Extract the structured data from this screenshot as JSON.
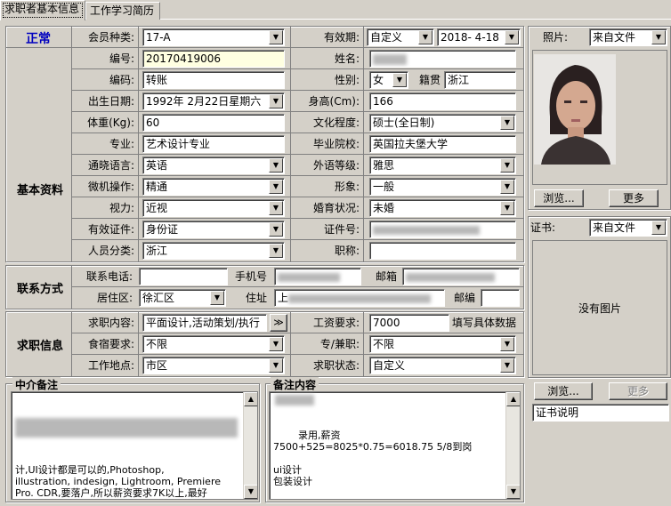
{
  "tabs": [
    "求职者基本信息",
    "工作学习简历"
  ],
  "status": "正常",
  "sections": {
    "basic": "基本资料",
    "contact": "联系方式",
    "job": "求职信息"
  },
  "labels": {
    "member_type": "会员种类:",
    "validity": "有效期:",
    "number": "编号:",
    "name": "姓名:",
    "code": "编码:",
    "gender": "性别:",
    "native": "籍贯",
    "birth": "出生日期:",
    "height": "身高(Cm):",
    "weight": "体重(Kg):",
    "education": "文化程度:",
    "major": "专业:",
    "school": "毕业院校:",
    "language": "通晓语言:",
    "lang_level": "外语等级:",
    "computer": "微机操作:",
    "image": "形象:",
    "eyesight": "视力:",
    "marital": "婚育状况:",
    "id_type": "有效证件:",
    "id_no": "证件号:",
    "category": "人员分类:",
    "title": "职称:",
    "phone": "联系电话:",
    "mobile": "手机号",
    "email": "邮箱",
    "district": "居住区:",
    "address": "住址",
    "postcode": "邮编",
    "job_content": "求职内容:",
    "salary": "工资要求:",
    "salary_note": "填写具体数据",
    "board": "食宿要求:",
    "fulltime": "专/兼职:",
    "location": "工作地点:",
    "job_status": "求职状态:",
    "agency_note": "中介备注",
    "remark": "备注内容",
    "photo": "照片:",
    "cert": "证书:"
  },
  "values": {
    "member_type": "17-A",
    "validity_type": "自定义",
    "validity_date": "2018- 4-18",
    "number": "20170419006",
    "code": "转账",
    "gender": "女",
    "native": "浙江",
    "birth": "1992年 2月22日星期六",
    "height": "166",
    "weight": "60",
    "education": "硕士(全日制)",
    "major": "艺术设计专业",
    "school": "英国拉夫堡大学",
    "language": "英语",
    "lang_level": "雅思",
    "computer": "精通",
    "image": "一般",
    "eyesight": "近视",
    "marital": "未婚",
    "id_type": "身份证",
    "category": "浙江",
    "district": "徐汇区",
    "address_prefix": "上",
    "job_content": "平面设计,活动策划/执行",
    "salary": "7000",
    "board": "不限",
    "fulltime": "不限",
    "location": "市区",
    "job_status": "自定义",
    "photo_source": "来自文件",
    "cert_source": "来自文件",
    "no_image": "没有图片",
    "cert_desc": "证书说明"
  },
  "agency_note_text": "计,UI设计都是可以的,Photoshop,\nillustration, indesign, Lightroom, Premiere\nPro. CDR,要落户,所以薪资要求7K以上,最好\n是外企,英语很好的,住         路程一小\n时都可以的",
  "remark_text": "        录用,薪资\n7500+525=8025*0.75=6018.75 5/8到岗\n\nui设计\n包装设计",
  "buttons": {
    "browse": "浏览...",
    "more": "更多",
    "expand": "≫"
  },
  "icons": {
    "dropdown": "chevron-down-icon",
    "scroll_up": "arrow-up-icon",
    "scroll_down": "arrow-down-icon"
  }
}
